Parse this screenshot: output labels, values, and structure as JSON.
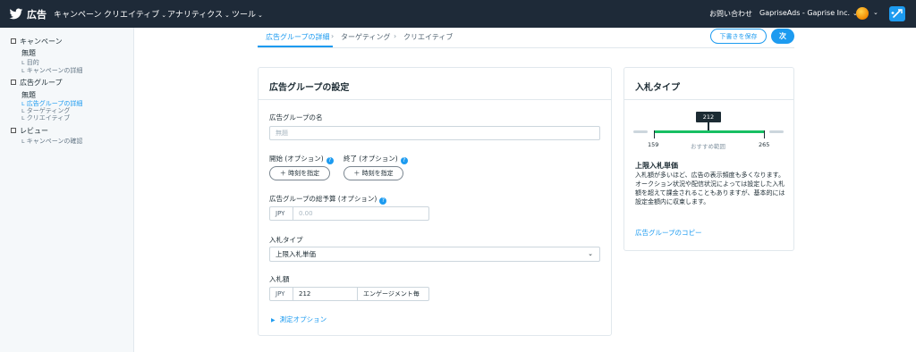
{
  "nav": {
    "brand": "広告",
    "items": [
      "キャンペーン",
      "クリエイティブ",
      "アナリティクス",
      "ツール"
    ],
    "contact": "お問い合わせ",
    "account": "GapriseAds - Gaprise Inc.",
    "icons": {
      "logo": "bird-logo-icon",
      "compose": "compose-icon",
      "avatar": "avatar"
    }
  },
  "sidebar": {
    "sections": [
      {
        "label": "キャンペーン",
        "item": "無題",
        "subs": [
          "目的",
          "キャンペーンの詳細"
        ]
      },
      {
        "label": "広告グループ",
        "item": "無題",
        "subs": [
          "広告グループの詳細",
          "ターゲティング",
          "クリエイティブ"
        ]
      },
      {
        "label": "レビュー",
        "subs": [
          "キャンペーンの確認"
        ]
      }
    ]
  },
  "steps": [
    "広告グループの詳細",
    "ターゲティング",
    "クリエイティブ"
  ],
  "actions": {
    "draft": "下書きを保存",
    "next": "次"
  },
  "form": {
    "title": "広告グループの設定",
    "name_label": "広告グループの名",
    "name_placeholder": "無題",
    "start_label": "開始 (オプション)",
    "end_label": "終了 (オプション)",
    "set_time": "＋ 時刻を指定",
    "budget_label": "広告グループの総予算 (オプション)",
    "currency": "JPY",
    "budget_placeholder": "0.00",
    "bid_type_label": "入札タイプ",
    "bid_type_value": "上限入札単価",
    "bid_amount_label": "入札額",
    "bid_amount": "212",
    "bid_unit": "エンゲージメント毎",
    "measure_link": "測定オプション"
  },
  "bid_panel": {
    "title": "入札タイプ",
    "current": "212",
    "min": "159",
    "max": "265",
    "recommended": "おすすめ範囲",
    "heading": "上限入札単価",
    "body": "入札額が多いほど、広告の表示頻度も多くなります。オークション状況や配信状況によっては設定した入札額を超えて課金されることもありますが、基本的には設定金額内に収束します。",
    "copy_link": "広告グループのコピー",
    "accent": "#17bf63"
  }
}
